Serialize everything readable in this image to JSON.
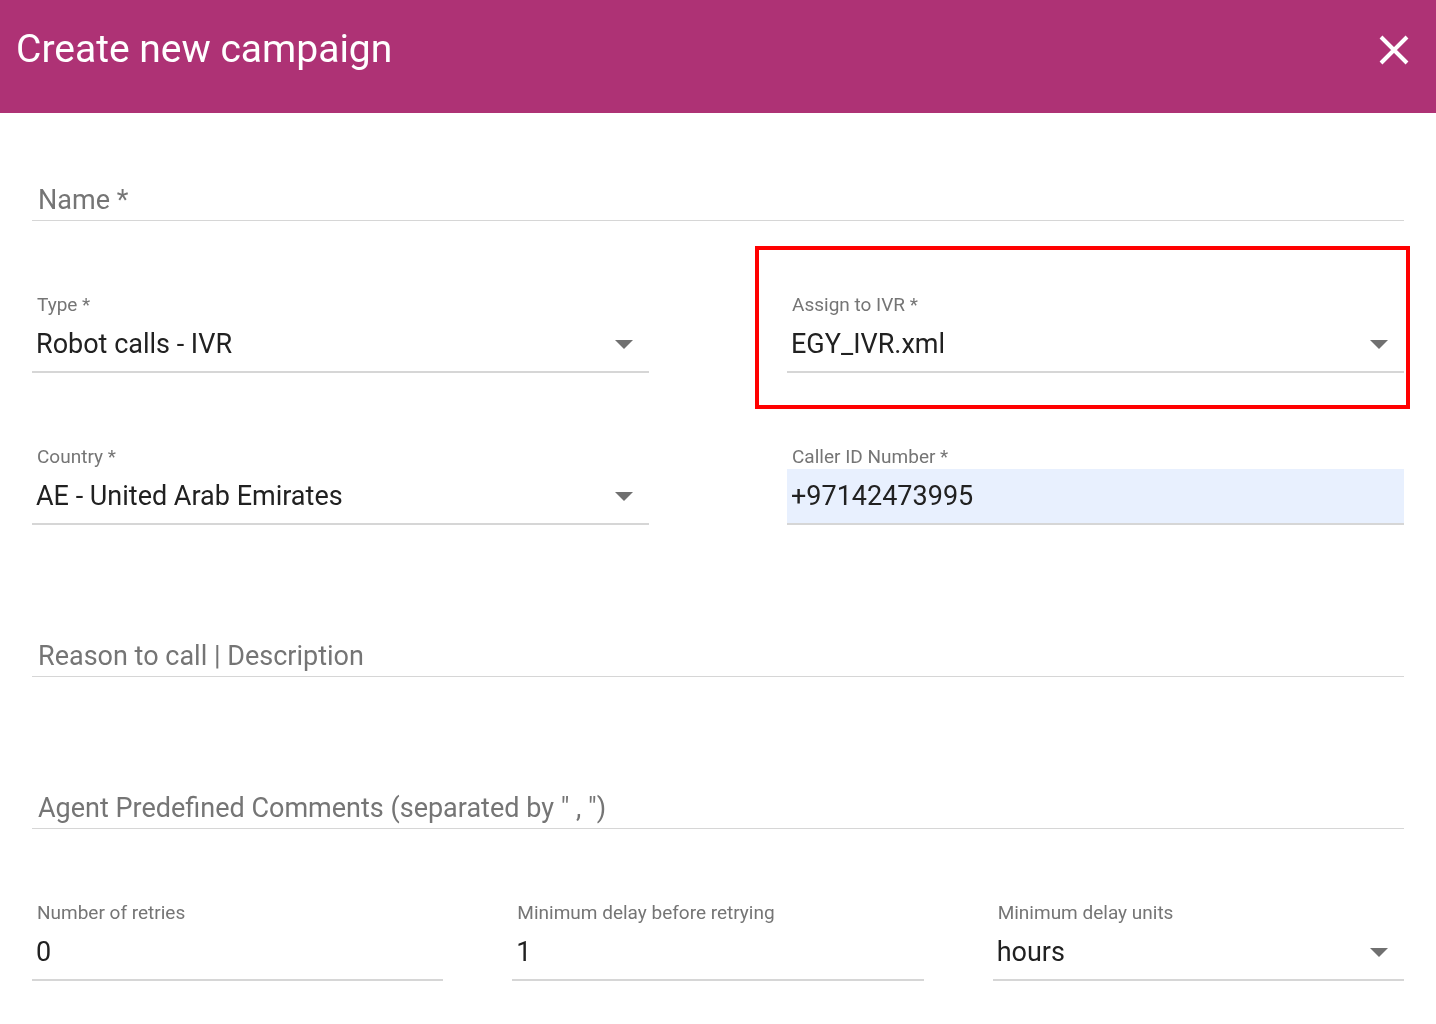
{
  "header": {
    "title": "Create new campaign"
  },
  "rows": [
    [
      {
        "kind": "text",
        "placeholder": "Name *",
        "highlighted": false,
        "autofilled": false
      }
    ],
    [
      {
        "kind": "select",
        "label": "Type *",
        "value": "Robot calls - IVR",
        "highlighted": false,
        "autofilled": false
      },
      {
        "kind": "select",
        "label": "Assign to IVR *",
        "value": "EGY_IVR.xml",
        "highlighted": true,
        "autofilled": false
      }
    ],
    [
      {
        "kind": "select",
        "label": "Country *",
        "value": "AE - United Arab Emirates",
        "highlighted": false,
        "autofilled": false
      },
      {
        "kind": "input",
        "label": "Caller ID Number *",
        "value": "+97142473995",
        "highlighted": false,
        "autofilled": true
      }
    ],
    [
      {
        "kind": "text",
        "placeholder": "Reason to call | Description",
        "highlighted": false,
        "autofilled": false
      }
    ],
    [
      {
        "kind": "text",
        "placeholder": "Agent Predefined Comments (separated by \" , \")",
        "highlighted": false,
        "autofilled": false
      }
    ],
    [
      {
        "kind": "input",
        "label": "Number of retries",
        "value": "0",
        "highlighted": false,
        "autofilled": false
      },
      {
        "kind": "input",
        "label": "Minimum delay before retrying",
        "value": "1",
        "highlighted": false,
        "autofilled": false
      },
      {
        "kind": "select",
        "label": "Minimum delay units",
        "value": "hours",
        "highlighted": false,
        "autofilled": false
      }
    ]
  ]
}
